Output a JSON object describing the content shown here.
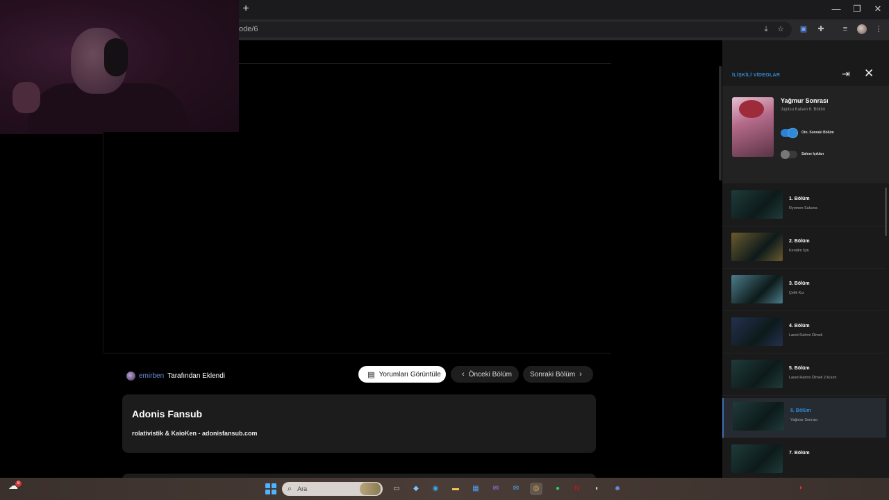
{
  "browser": {
    "new_tab_label": "+",
    "url": "ode/6",
    "window_controls": {
      "minimize": "—",
      "maximize": "❐",
      "close": "✕"
    }
  },
  "page": {
    "uploader": {
      "username": "emirben",
      "added_by_text": "Tarafından Eklendi"
    },
    "buttons": {
      "comments": "Yorumları Görüntüle",
      "previous": "Önceki Bölüm",
      "next": "Sonraki Bölüm"
    },
    "fansub": {
      "title": "Adonis Fansub",
      "credits": "rolativistik & KaioKen - adonisfansub.com"
    }
  },
  "sidebar": {
    "heading": "İLİŞKİLİ VİDEOLAR",
    "now_playing": {
      "title": "Yağmur Sonrası",
      "subtitle": "Jujutsu Kaisen 6. Bölüm",
      "autoplay_label": "Oto. Sonraki Bölüm",
      "autoplay_on": true,
      "lights_label": "Sahne Işıkları",
      "lights_on": false
    },
    "episodes": [
      {
        "title": "1. Bölüm",
        "subtitle": "Ryomen Sukuna",
        "thumb": "#1f3b3a"
      },
      {
        "title": "2. Bölüm",
        "subtitle": "Kendim İçin",
        "thumb": "#6a5a2e"
      },
      {
        "title": "3. Bölüm",
        "subtitle": "Çelik Kız",
        "thumb": "#4b7c8a"
      },
      {
        "title": "4. Bölüm",
        "subtitle": "Lanet Rahmi Ölmeli",
        "thumb": "#23304f"
      },
      {
        "title": "5. Bölüm",
        "subtitle": "Lanet Rahmi Ölmeli 2.Kısım",
        "thumb": "#1f3b3a"
      },
      {
        "title": "6. Bölüm",
        "subtitle": "Yağmur Sonrası",
        "thumb": "#1f3b3a",
        "active": true
      },
      {
        "title": "7. Bölüm",
        "subtitle": "",
        "thumb": "#1f3b3a"
      }
    ]
  },
  "taskbar": {
    "weather_badge": "8",
    "search_placeholder": "Ara"
  },
  "colors": {
    "accent": "#2f8bd8",
    "sidebar_bg": "#1a1a1a",
    "card_bg": "#1c1c1c",
    "username": "#6b8cd6"
  }
}
